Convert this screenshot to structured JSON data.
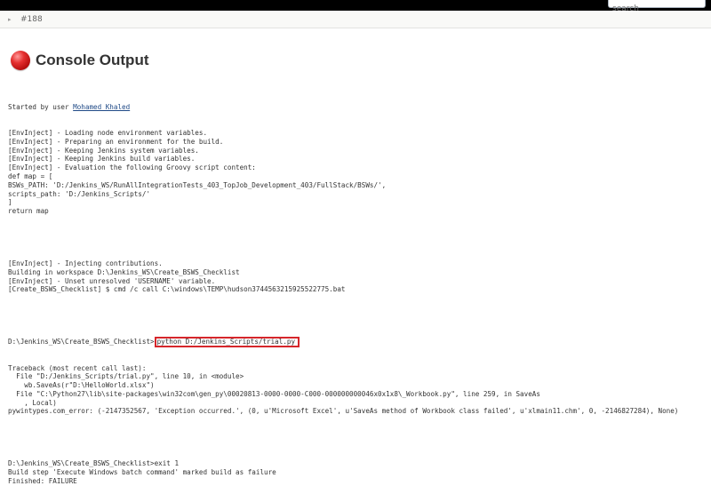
{
  "header": {
    "search_placeholder": "search"
  },
  "breadcrumb": {
    "arrow": "▸",
    "build_label": "#188"
  },
  "page": {
    "title": "Console Output",
    "status_icon": "red-ball-icon",
    "status_color": "#e53030"
  },
  "console": {
    "started_prefix": "Started by user ",
    "started_user": "Mohamed Khaled",
    "block1": [
      "[EnvInject] - Loading node environment variables.",
      "[EnvInject] - Preparing an environment for the build.",
      "[EnvInject] - Keeping Jenkins system variables.",
      "[EnvInject] - Keeping Jenkins build variables.",
      "[EnvInject] - Evaluation the following Groovy script content:",
      "def map = [",
      "BSWs_PATH: 'D:/Jenkins_WS/RunAllIntegrationTests_403_TopJob_Development_403/FullStack/BSWs/',",
      "scripts_path: 'D:/Jenkins_Scripts/'",
      "]",
      "return map"
    ],
    "block2": [
      "[EnvInject] - Injecting contributions.",
      "Building in workspace D:\\Jenkins_WS\\Create_BSWS_Checklist",
      "[EnvInject] - Unset unresolved 'USERNAME' variable.",
      "[Create_BSWS_Checklist] $ cmd /c call C:\\windows\\TEMP\\hudson3744563215925522775.bat"
    ],
    "cmd_prefix": "D:\\Jenkins_WS\\Create_BSWS_Checklist>",
    "cmd_highlight": "python D:/Jenkins_Scripts/trial.py",
    "highlight_color": "#d6262b",
    "block3": [
      "Traceback (most recent call last):",
      "  File \"D:/Jenkins_Scripts/trial.py\", line 10, in <module>",
      "    wb.SaveAs(r\"D:\\HelloWorld.xlsx\")",
      "  File \"C:\\Python27\\lib\\site-packages\\win32com\\gen_py\\00020813-0000-0000-C000-000000000046x0x1x8\\_Workbook.py\", line 259, in SaveAs",
      "    , Local)",
      "pywintypes.com_error: (-2147352567, 'Exception occurred.', (0, u'Microsoft Excel', u'SaveAs method of Workbook class failed', u'xlmain11.chm', 0, -2146827284), None)"
    ],
    "block4": [
      "D:\\Jenkins_WS\\Create_BSWS_Checklist>exit 1",
      "Build step 'Execute Windows batch command' marked build as failure",
      "Finished: FAILURE"
    ]
  }
}
